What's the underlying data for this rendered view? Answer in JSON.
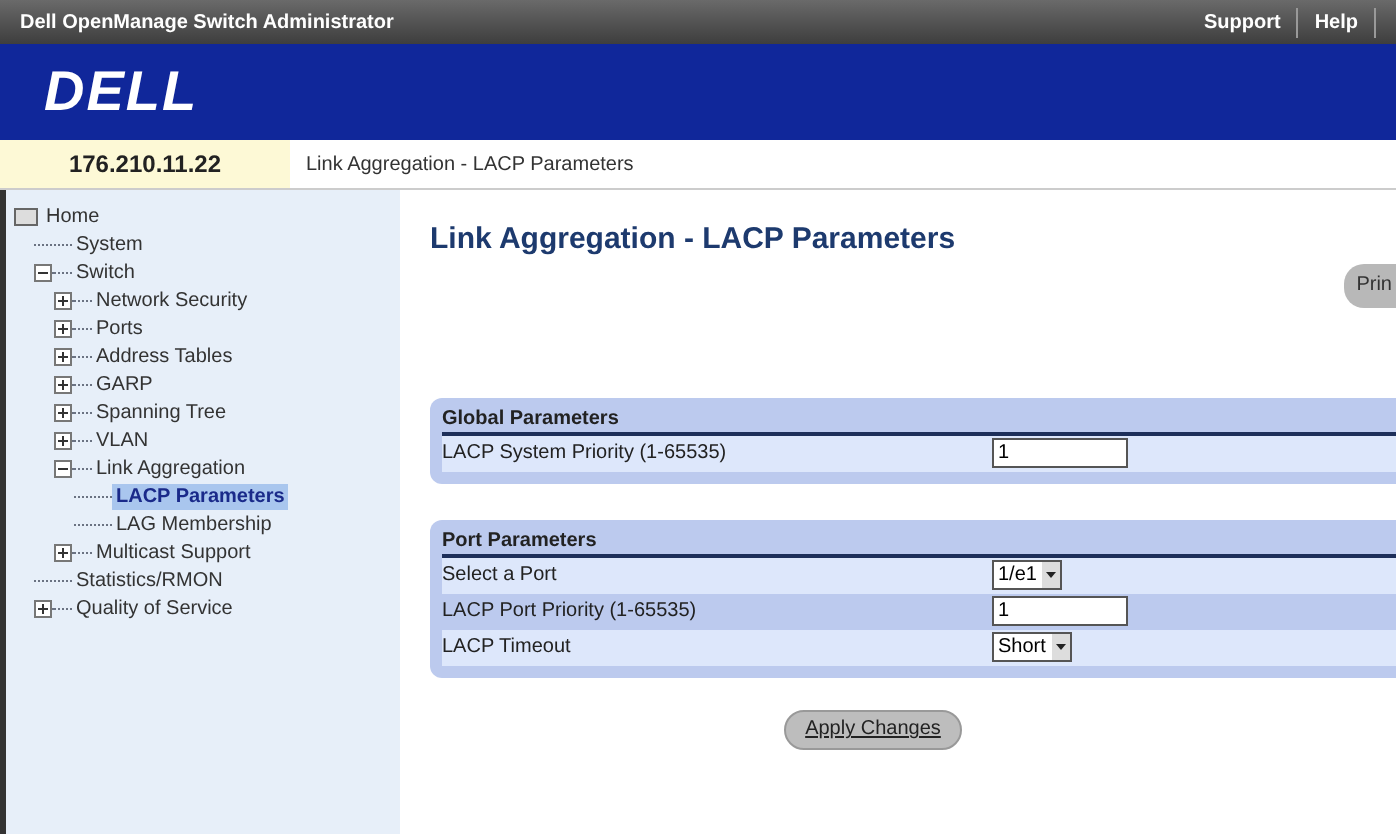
{
  "title_bar": {
    "title": "Dell OpenManage Switch Administrator",
    "links": [
      "Support",
      "Help"
    ]
  },
  "logo": "DELL",
  "ip_address": "176.210.11.22",
  "breadcrumb": "Link Aggregation - LACP Parameters",
  "sidebar": {
    "items": [
      {
        "label": "Home",
        "kind": "root",
        "selected": false,
        "children": [
          {
            "label": "System",
            "kind": "leaf",
            "selected": false
          },
          {
            "label": "Switch",
            "kind": "folder",
            "expanded": true,
            "selected": false,
            "children": [
              {
                "label": "Network Security",
                "kind": "folder",
                "expanded": false,
                "selected": false
              },
              {
                "label": "Ports",
                "kind": "folder",
                "expanded": false,
                "selected": false
              },
              {
                "label": "Address Tables",
                "kind": "folder",
                "expanded": false,
                "selected": false
              },
              {
                "label": "GARP",
                "kind": "folder",
                "expanded": false,
                "selected": false
              },
              {
                "label": "Spanning Tree",
                "kind": "folder",
                "expanded": false,
                "selected": false
              },
              {
                "label": "VLAN",
                "kind": "folder",
                "expanded": false,
                "selected": false
              },
              {
                "label": "Link Aggregation",
                "kind": "folder",
                "expanded": true,
                "selected": false,
                "children": [
                  {
                    "label": "LACP Parameters",
                    "kind": "leaf",
                    "selected": true
                  },
                  {
                    "label": "LAG Membership",
                    "kind": "leaf",
                    "selected": false
                  }
                ]
              },
              {
                "label": "Multicast Support",
                "kind": "folder",
                "expanded": false,
                "selected": false
              }
            ]
          },
          {
            "label": "Statistics/RMON",
            "kind": "leaf",
            "selected": false
          },
          {
            "label": "Quality of Service",
            "kind": "folder",
            "expanded": false,
            "selected": false
          }
        ]
      }
    ]
  },
  "page_title": "Link Aggregation - LACP Parameters",
  "print_button": "Prin",
  "sections": [
    {
      "title": "Global Parameters",
      "rows": [
        {
          "label": "LACP System Priority (1-65535)",
          "kind": "text",
          "value": "1"
        }
      ]
    },
    {
      "title": "Port Parameters",
      "rows": [
        {
          "label": "Select a Port",
          "kind": "select",
          "value": "1/e1"
        },
        {
          "label": "LACP Port Priority (1-65535)",
          "kind": "text",
          "value": "1"
        },
        {
          "label": "LACP Timeout",
          "kind": "select",
          "value": "Short"
        }
      ]
    }
  ],
  "apply_button": "Apply Changes"
}
